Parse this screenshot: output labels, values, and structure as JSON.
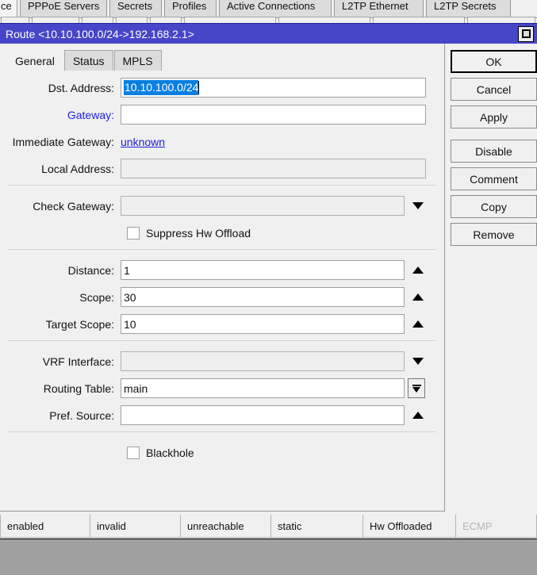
{
  "background": {
    "tabs": [
      {
        "label": "ce",
        "active": true,
        "width": 46,
        "clipped": true
      },
      {
        "label": "PPPoE Servers",
        "active": false,
        "width": 110
      },
      {
        "label": "Secrets",
        "active": false,
        "width": 66
      },
      {
        "label": "Profiles",
        "active": false,
        "width": 66
      },
      {
        "label": "Active Connections",
        "active": false,
        "width": 142
      },
      {
        "label": "L2TP Ethernet",
        "active": false,
        "width": 113
      },
      {
        "label": "L2TP Secrets",
        "active": false,
        "width": 107
      }
    ],
    "toolbar_buttons": [
      {
        "name": "toolbar-button-1",
        "width": 36
      },
      {
        "name": "toolbar-button-2",
        "width": 60
      },
      {
        "name": "toolbar-button-3",
        "width": 40
      },
      {
        "name": "toolbar-button-4",
        "width": 40
      },
      {
        "name": "toolbar-button-5",
        "width": 40
      },
      {
        "name": "toolbar-button-6",
        "width": 116
      },
      {
        "name": "toolbar-button-7",
        "width": 116
      },
      {
        "name": "toolbar-button-8",
        "width": 116
      },
      {
        "name": "toolbar-button-9",
        "width": 86
      }
    ],
    "status_flags": [
      {
        "label": "enabled",
        "width": 114,
        "disabled": false
      },
      {
        "label": "invalid",
        "width": 114,
        "disabled": false
      },
      {
        "label": "unreachable",
        "width": 114,
        "disabled": false
      },
      {
        "label": "static",
        "width": 116,
        "disabled": false
      },
      {
        "label": "Hw Offloaded",
        "width": 117,
        "disabled": false
      },
      {
        "label": "ECMP",
        "width": 102,
        "disabled": true
      }
    ]
  },
  "dialog": {
    "title": "Route <10.10.100.0/24->192.168.2.1>",
    "restore_button_icon": "restore-window-icon",
    "tabs": [
      {
        "label": "General",
        "active": true
      },
      {
        "label": "Status",
        "active": false
      },
      {
        "label": "MPLS",
        "active": false
      }
    ],
    "fields": {
      "dst_address": {
        "label": "Dst. Address:",
        "value": "10.10.100.0/24",
        "selected": true
      },
      "gateway": {
        "label": "Gateway:",
        "value": "",
        "placeholder": ""
      },
      "immediate_gateway": {
        "label": "Immediate Gateway:",
        "value": "unknown"
      },
      "local_address": {
        "label": "Local Address:",
        "value": ""
      },
      "check_gateway": {
        "label": "Check Gateway:",
        "value": ""
      },
      "suppress_hw_offload": {
        "label": "Suppress Hw Offload",
        "checked": false
      },
      "distance": {
        "label": "Distance:",
        "value": "1"
      },
      "scope": {
        "label": "Scope:",
        "value": "30"
      },
      "target_scope": {
        "label": "Target Scope:",
        "value": "10"
      },
      "vrf_interface": {
        "label": "VRF Interface:",
        "value": ""
      },
      "routing_table": {
        "label": "Routing Table:",
        "value": "main"
      },
      "pref_source": {
        "label": "Pref. Source:",
        "value": ""
      },
      "blackhole": {
        "label": "Blackhole",
        "checked": false
      }
    },
    "buttons": [
      {
        "label": "OK",
        "default": true
      },
      {
        "label": "Cancel",
        "default": false
      },
      {
        "label": "Apply",
        "default": false
      },
      {
        "label": "Disable",
        "default": false
      },
      {
        "label": "Comment",
        "default": false
      },
      {
        "label": "Copy",
        "default": false
      },
      {
        "label": "Remove",
        "default": false
      }
    ]
  },
  "colors": {
    "titlebar": "#4646c8",
    "selection": "#0b7fe0",
    "link": "#2020dd",
    "window": "#f0f0f0",
    "desktop": "#a0a0a0"
  }
}
